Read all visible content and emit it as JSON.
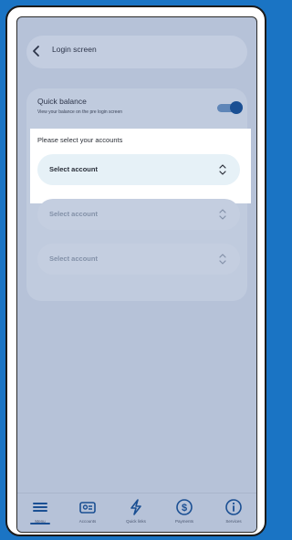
{
  "header": {
    "title": "Login screen",
    "back_icon": "chevron-left-icon"
  },
  "quick_balance": {
    "title": "Quick balance",
    "subtitle": "View your balance on the pre login screen",
    "toggle_on": true
  },
  "account_selection": {
    "prompt": "Please select your accounts",
    "rows": [
      {
        "label": "Select account",
        "icon": "chevron-up-down-icon"
      },
      {
        "label": "Select account",
        "icon": "chevron-up-down-icon"
      },
      {
        "label": "Select account",
        "icon": "chevron-up-down-icon"
      }
    ]
  },
  "bottom_nav": {
    "items": [
      {
        "label": "Menu",
        "icon": "menu-icon",
        "active": true
      },
      {
        "label": "Accounts",
        "icon": "accounts-icon"
      },
      {
        "label": "Quick links",
        "icon": "lightning-icon"
      },
      {
        "label": "Payments",
        "icon": "dollar-icon"
      },
      {
        "label": "Services",
        "icon": "info-icon"
      }
    ]
  },
  "colors": {
    "background": "#1a74c4",
    "accent": "#1a4f93",
    "overlay": "#b6c2d8"
  }
}
